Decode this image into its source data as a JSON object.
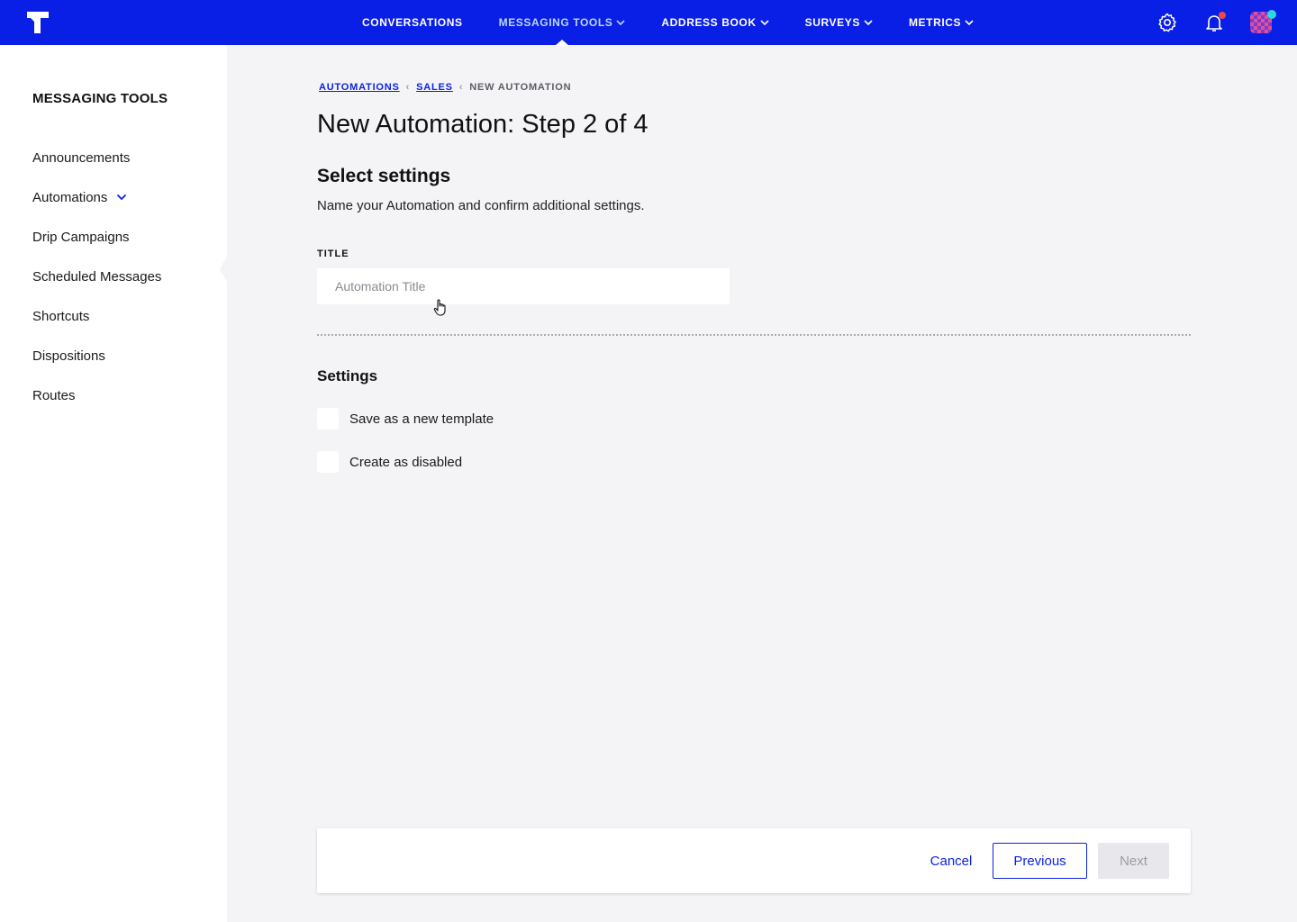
{
  "nav": {
    "items": [
      {
        "label": "CONVERSATIONS",
        "dropdown": false,
        "active": false
      },
      {
        "label": "MESSAGING TOOLS",
        "dropdown": true,
        "active": true
      },
      {
        "label": "ADDRESS BOOK",
        "dropdown": true,
        "active": false
      },
      {
        "label": "SURVEYS",
        "dropdown": true,
        "active": false
      },
      {
        "label": "METRICS",
        "dropdown": true,
        "active": false
      }
    ],
    "icons": [
      "settings-icon",
      "notification-bell-icon",
      "user-avatar"
    ],
    "colors": {
      "bar": "#0a1fe6",
      "active_item": "#b9d7ff",
      "notification_dot": "#f0483e",
      "avatar_status_dot": "#2fd5e0"
    }
  },
  "sidebar": {
    "title": "MESSAGING TOOLS",
    "items": [
      {
        "label": "Announcements"
      },
      {
        "label": "Automations",
        "expandable": true
      },
      {
        "label": "Drip Campaigns"
      },
      {
        "label": "Scheduled Messages"
      },
      {
        "label": "Shortcuts"
      },
      {
        "label": "Dispositions"
      },
      {
        "label": "Routes"
      }
    ]
  },
  "breadcrumb": {
    "items": [
      {
        "label": "AUTOMATIONS",
        "link": true
      },
      {
        "label": "SALES",
        "link": true
      },
      {
        "label": "NEW AUTOMATION",
        "link": false
      }
    ]
  },
  "main": {
    "page_title": "New Automation: Step 2 of 4",
    "section_title": "Select settings",
    "section_desc": "Name your Automation and confirm additional settings.",
    "title_field": {
      "label": "TITLE",
      "placeholder": "Automation Title",
      "value": ""
    },
    "settings": {
      "title": "Settings",
      "options": [
        {
          "label": "Save as a new template",
          "checked": false
        },
        {
          "label": "Create as disabled",
          "checked": false
        }
      ]
    }
  },
  "footer": {
    "cancel_label": "Cancel",
    "previous_label": "Previous",
    "next_label": "Next",
    "next_disabled": true
  }
}
